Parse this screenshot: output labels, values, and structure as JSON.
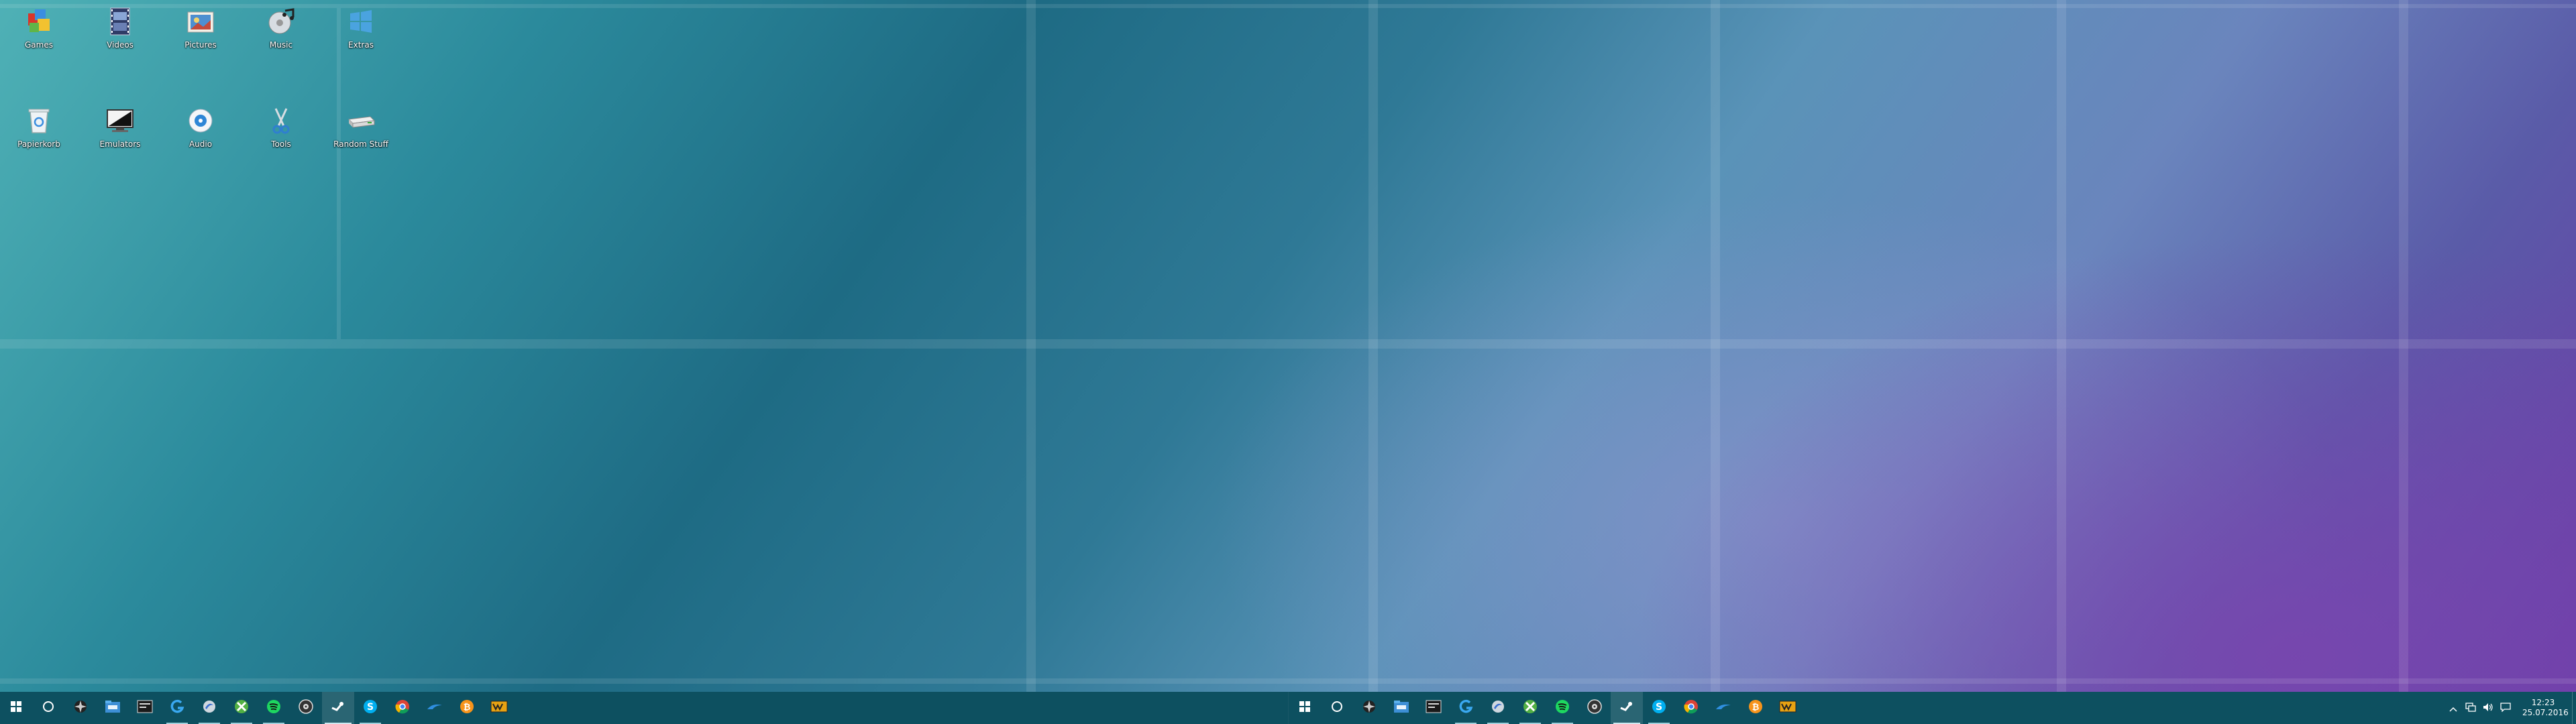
{
  "desktop": {
    "icons": [
      {
        "label": "Games",
        "icon": "games-icon"
      },
      {
        "label": "Videos",
        "icon": "videos-icon"
      },
      {
        "label": "Pictures",
        "icon": "pictures-icon"
      },
      {
        "label": "Music",
        "icon": "music-icon"
      },
      {
        "label": "Extras",
        "icon": "extras-icon"
      },
      {
        "label": "Papierkorb",
        "icon": "recycle-bin-icon"
      },
      {
        "label": "Emulators",
        "icon": "emulators-icon"
      },
      {
        "label": "Audio",
        "icon": "audio-icon"
      },
      {
        "label": "Tools",
        "icon": "tools-icon"
      },
      {
        "label": "Random Stuff",
        "icon": "drive-icon"
      }
    ]
  },
  "taskbar": {
    "apps": [
      {
        "name": "start",
        "icon": "windows-start-icon"
      },
      {
        "name": "search",
        "icon": "search-circle-icon"
      },
      {
        "name": "blender",
        "icon": "blender-icon"
      },
      {
        "name": "file-explorer",
        "icon": "file-explorer-icon"
      },
      {
        "name": "terminal",
        "icon": "terminal-icon"
      },
      {
        "name": "logitech",
        "icon": "logitech-g-icon"
      },
      {
        "name": "app-swirl",
        "icon": "swirl-app-icon"
      },
      {
        "name": "xbox",
        "icon": "xbox-icon"
      },
      {
        "name": "spotify",
        "icon": "spotify-icon"
      },
      {
        "name": "mpc",
        "icon": "media-player-icon"
      },
      {
        "name": "steam",
        "icon": "steam-icon"
      },
      {
        "name": "skype",
        "icon": "skype-icon"
      },
      {
        "name": "chrome",
        "icon": "chrome-icon"
      },
      {
        "name": "trackmania",
        "icon": "trackmania-icon"
      },
      {
        "name": "bitcoin",
        "icon": "bitcoin-icon"
      },
      {
        "name": "winamp",
        "icon": "winamp-icon"
      }
    ],
    "tray": {
      "time": "12:23",
      "date": "25.07.2016",
      "icons": [
        "chevron-up-icon",
        "network-icon",
        "volume-icon",
        "action-center-icon"
      ]
    }
  },
  "colors": {
    "taskbar_bg": "#0d5060",
    "accent": "#9fd0dc"
  }
}
